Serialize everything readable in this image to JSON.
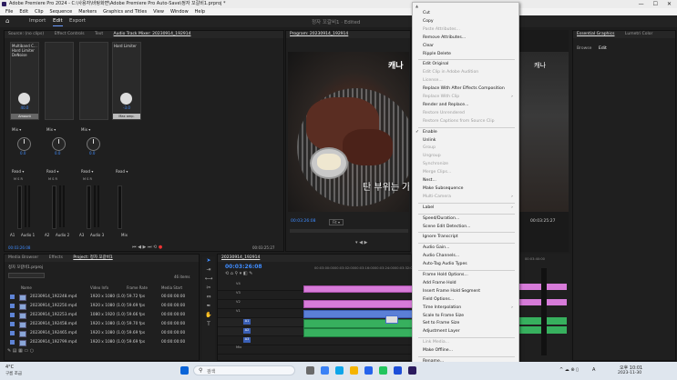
{
  "window": {
    "title": "Adobe Premiere Pro 2024 - C:\\사용자\\바탕화면\\Adobe Premiere Pro Auto-Save\\정자 꼬갈비1.prproj *",
    "controls": [
      "—",
      "☐",
      "✕"
    ]
  },
  "menubar": [
    "File",
    "Edit",
    "Clip",
    "Sequence",
    "Markers",
    "Graphics and Titles",
    "View",
    "Window",
    "Help"
  ],
  "workspace": {
    "tabs": [
      "Import",
      "Edit",
      "Export"
    ],
    "active": "Edit",
    "center_title": "정자 꼬갈비1 · Edited"
  },
  "source_panel": {
    "tabs": [
      "Source: (no clips)",
      "Effect Controls",
      "Text",
      "Audio Track Mixer: 20230914_192914"
    ],
    "channel_labels": [
      "Audio 1",
      "Audio 2",
      "Audio 3",
      "Mix"
    ],
    "channel_ids": [
      "A1",
      "A2",
      "A3"
    ],
    "read_labels": [
      "Read",
      "Read",
      "Read",
      "Read"
    ],
    "knob_values": [
      "0.0",
      "0.0",
      "0.0",
      "0.0"
    ],
    "preset_lines": [
      "Multiband C...",
      "Hard Limiter",
      "DeNoise"
    ],
    "preset_value": "40.0",
    "preset_amount": "Amount",
    "mix_label": "Hard Limiter",
    "mix_value": "-3.0",
    "mix_sub": "Max amp.",
    "time_left": "00:03:26:08",
    "time_right": "00:03:25:27"
  },
  "program": {
    "tab": "Program: 20230914_192914",
    "subtitle": "탄 부위는 가",
    "timecode": "00:03:26:08",
    "fit": "Fit",
    "duration": "00:03:25:27",
    "corner_text": "캐나"
  },
  "right_panel": {
    "tabs": [
      "Essential Graphics",
      "Lumetri Color"
    ],
    "subtabs": [
      "Browse",
      "Edit"
    ]
  },
  "project_panel": {
    "tabs": [
      "Media Browser",
      "Effects",
      "Project: 정자 꼬갈비1"
    ],
    "file": "정자 꼬갈비1.prproj",
    "count": "46 items",
    "columns": [
      "Name",
      "Video Info",
      "Frame Rate",
      "Media Start"
    ],
    "rows": [
      {
        "name": "20230914_192248.mp4",
        "info": "1920 x 1080 (1.0)",
        "rate": "59.72 fps",
        "start": "00:00:00:00"
      },
      {
        "name": "20230914_192250.mp4",
        "info": "1920 x 1080 (1.0)",
        "rate": "59.69 fps",
        "start": "00:00:00:00"
      },
      {
        "name": "20230914_192253.mp4",
        "info": "1080 x 1920 (1.0)",
        "rate": "59.66 fps",
        "start": "00:00:00:00"
      },
      {
        "name": "20230914_192458.mp4",
        "info": "1920 x 1080 (1.0)",
        "rate": "59.70 fps",
        "start": "00:00:00:00"
      },
      {
        "name": "20230914_192465.mp4",
        "info": "1920 x 1080 (1.0)",
        "rate": "59.69 fps",
        "start": "00:00:00:00"
      },
      {
        "name": "20230914_192799.mp4",
        "info": "1920 x 1080 (1.0)",
        "rate": "59.69 fps",
        "start": "00:00:00:00"
      }
    ]
  },
  "timeline": {
    "tab": "20230914_192914",
    "timecode": "00:03:26:08",
    "ruler": [
      "00:03:00:00",
      "00:03:02:00",
      "00:03:16:00",
      "00:03:24:00",
      "00:03:32:00",
      "00:03:40:00"
    ],
    "tracks": [
      "V4",
      "V3",
      "V2",
      "V1",
      "A1",
      "A2",
      "A3",
      "Mix"
    ]
  },
  "context_menu": {
    "items": [
      {
        "label": "Cut",
        "enabled": true
      },
      {
        "label": "Copy",
        "enabled": true
      },
      {
        "label": "Paste Attributes...",
        "enabled": false
      },
      {
        "label": "Remove Attributes...",
        "enabled": true
      },
      {
        "label": "Clear",
        "enabled": true
      },
      {
        "label": "Ripple Delete",
        "enabled": true
      },
      {
        "sep": true
      },
      {
        "label": "Edit Original",
        "enabled": true
      },
      {
        "label": "Edit Clip in Adobe Audition",
        "enabled": false
      },
      {
        "label": "License...",
        "enabled": false
      },
      {
        "label": "Replace With After Effects Composition",
        "enabled": true
      },
      {
        "label": "Replace With Clip",
        "enabled": false,
        "submenu": true
      },
      {
        "label": "Render and Replace...",
        "enabled": true
      },
      {
        "label": "Restore Unrendered",
        "enabled": false
      },
      {
        "label": "Restore Captions from Source Clip",
        "enabled": false
      },
      {
        "sep": true
      },
      {
        "label": "Enable",
        "enabled": true,
        "checked": true
      },
      {
        "label": "Unlink",
        "enabled": true
      },
      {
        "label": "Group",
        "enabled": false
      },
      {
        "label": "Ungroup",
        "enabled": false
      },
      {
        "label": "Synchronize",
        "enabled": false
      },
      {
        "label": "Merge Clips...",
        "enabled": false
      },
      {
        "label": "Nest...",
        "enabled": true
      },
      {
        "label": "Make Subsequence",
        "enabled": true
      },
      {
        "label": "Multi-Camera",
        "enabled": false,
        "submenu": true
      },
      {
        "sep": true
      },
      {
        "label": "Label",
        "enabled": true,
        "submenu": true
      },
      {
        "sep": true
      },
      {
        "label": "Speed/Duration...",
        "enabled": true
      },
      {
        "label": "Scene Edit Detection...",
        "enabled": true
      },
      {
        "sep": true
      },
      {
        "label": "Ignore Transcript",
        "enabled": true
      },
      {
        "sep": true
      },
      {
        "label": "Audio Gain...",
        "enabled": true
      },
      {
        "label": "Audio Channels...",
        "enabled": true
      },
      {
        "label": "Auto-Tag Audio Types",
        "enabled": true
      },
      {
        "sep": true
      },
      {
        "label": "Frame Hold Options...",
        "enabled": true
      },
      {
        "label": "Add Frame Hold",
        "enabled": true
      },
      {
        "label": "Insert Frame Hold Segment",
        "enabled": true
      },
      {
        "label": "Field Options...",
        "enabled": true
      },
      {
        "label": "Time Interpolation",
        "enabled": true,
        "submenu": true
      },
      {
        "label": "Scale to Frame Size",
        "enabled": true
      },
      {
        "label": "Set to Frame Size",
        "enabled": true
      },
      {
        "label": "Adjustment Layer",
        "enabled": true
      },
      {
        "sep": true
      },
      {
        "label": "Link Media...",
        "enabled": false
      },
      {
        "label": "Make Offline...",
        "enabled": true
      },
      {
        "sep": true
      },
      {
        "label": "Rename...",
        "enabled": true
      }
    ]
  },
  "taskbar": {
    "weather_temp": "4°C",
    "weather_desc": "구름 조금",
    "search_placeholder": "검색",
    "time": "오후 10:01",
    "date": "2023-11-30",
    "lang": "A"
  },
  "colors": {
    "accent": "#3f8cff",
    "clip_pink": "#d77bd9",
    "clip_green": "#37b05e",
    "menu_bg": "#f2f2f2"
  }
}
